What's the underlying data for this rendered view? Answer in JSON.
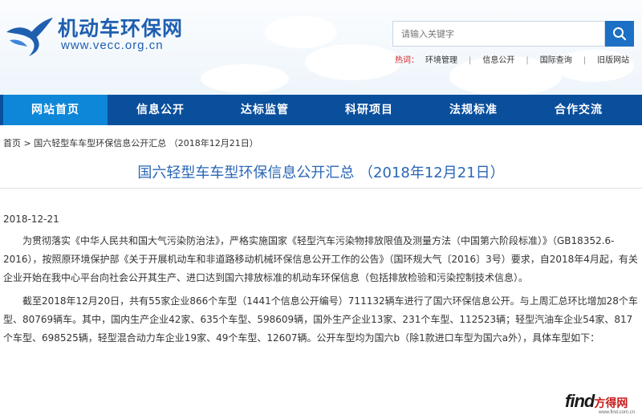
{
  "header": {
    "site_title": "机动车环保网",
    "site_url": "www.vecc.org.cn",
    "search": {
      "placeholder": "请输入关键字"
    },
    "hot": {
      "label": "热词：",
      "links": [
        "环境管理",
        "信息公开",
        "国际查询",
        "旧版网站"
      ]
    }
  },
  "nav": {
    "items": [
      "网站首页",
      "信息公开",
      "达标监管",
      "科研项目",
      "法规标准",
      "合作交流"
    ],
    "active_index": 0
  },
  "breadcrumb": {
    "home": "首页",
    "separator": " > ",
    "current": "国六轻型车车型环保信息公开汇总 （2018年12月21日）"
  },
  "article": {
    "title": "国六轻型车车型环保信息公开汇总 （2018年12月21日）",
    "date": "2018-12-21",
    "paragraphs": [
      "为贯彻落实《中华人民共和国大气污染防治法》，严格实施国家《轻型汽车污染物排放限值及测量方法（中国第六阶段标准）》（GB18352.6-2016），按照原环境保护部《关于开展机动车和非道路移动机械环保信息公开工作的公告》（国环规大气〔2016〕3号）要求，自2018年4月起，有关企业开始在我中心平台向社会公开其生产、进口达到国六排放标准的机动车环保信息（包括排放检验和污染控制技术信息）。",
      "截至2018年12月20日，共有55家企业866个车型（1441个信息公开编号）711132辆车进行了国六环保信息公开。与上周汇总环比增加28个车型、80769辆车。其中，国内生产企业42家、635个车型、598609辆，国外生产企业13家、231个车型、112523辆；轻型汽油车企业54家、817个车型、698525辆，轻型混合动力车企业19家、49个车型、12607辆。公开车型均为国六b（除1款进口车型为国六a外），具体车型如下："
    ]
  },
  "watermark": {
    "find": "find",
    "cn": "方得网",
    "small": "www.find.com.cn"
  },
  "colors": {
    "nav_bg": "#0a4f9c",
    "nav_active": "#0e87d8",
    "title_blue": "#2a67b6",
    "brand_blue": "#1f5fb0",
    "hot_red": "#d01f1f"
  }
}
